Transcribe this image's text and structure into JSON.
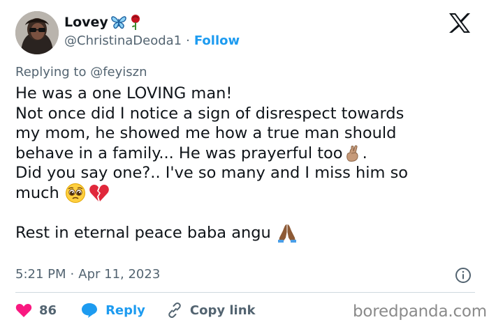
{
  "user": {
    "display_name": "Lovey",
    "name_emojis": [
      "butterfly-emoji",
      "rose-emoji"
    ],
    "handle": "@ChristinaDeoda1",
    "separator": "·",
    "follow_label": "Follow"
  },
  "reply_context": {
    "prefix": "Replying to",
    "handle": "@feyiszn"
  },
  "tweet": {
    "line1": "He was a one LOVING man!",
    "line2": "Not once did I notice a sign of disrespect towards",
    "line3": "my mom, he showed me how a true man should",
    "line4a": "behave in a family... He was prayerful too",
    "line4b": ".",
    "line5": "Did you say one?.. I've so many and I miss him so",
    "line6": "much",
    "line7": "Rest in eternal peace baba angu"
  },
  "meta": {
    "time": "5:21 PM",
    "separator": "·",
    "date": "Apr 11, 2023"
  },
  "actions": {
    "like_count": "86",
    "reply_label": "Reply",
    "copy_label": "Copy link"
  },
  "watermark": "boredpanda.com",
  "colors": {
    "accent": "#1d9bf0",
    "like": "#f91880",
    "muted": "#536471",
    "text": "#0f1419"
  }
}
